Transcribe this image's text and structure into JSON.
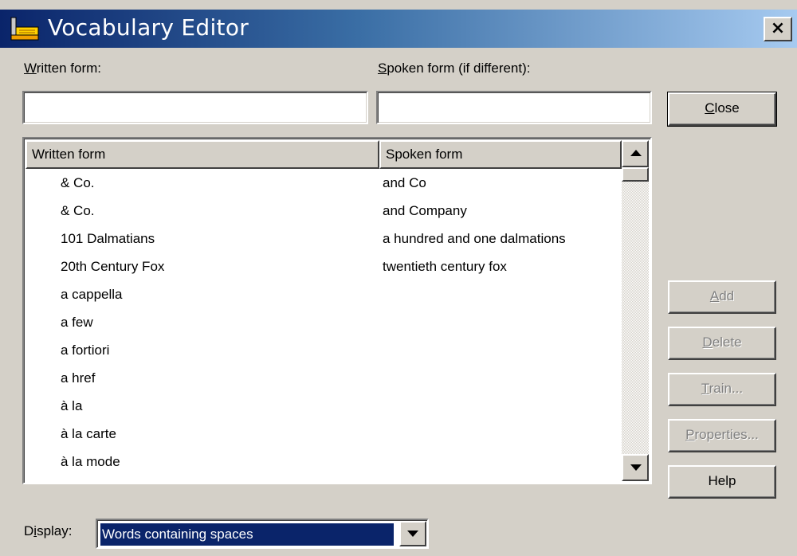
{
  "window": {
    "title": "Vocabulary Editor",
    "close_glyph": "×"
  },
  "form": {
    "written_label_accel": "W",
    "written_label_rest": "ritten form:",
    "written_value": "",
    "spoken_label_accel": "S",
    "spoken_label_rest": "poken form (if different):",
    "spoken_value": ""
  },
  "list": {
    "headers": {
      "written": "Written form",
      "spoken": "Spoken form"
    },
    "rows": [
      {
        "written": "& Co.",
        "spoken": "and Co"
      },
      {
        "written": "& Co.",
        "spoken": "and Company"
      },
      {
        "written": "101 Dalmatians",
        "spoken": "a hundred and one dalmations"
      },
      {
        "written": "20th Century Fox",
        "spoken": "twentieth century fox"
      },
      {
        "written": "a cappella",
        "spoken": ""
      },
      {
        "written": "a few",
        "spoken": ""
      },
      {
        "written": "a fortiori",
        "spoken": ""
      },
      {
        "written": "a href",
        "spoken": ""
      },
      {
        "written": "à la",
        "spoken": ""
      },
      {
        "written": "à la carte",
        "spoken": ""
      },
      {
        "written": "à la mode",
        "spoken": ""
      }
    ]
  },
  "buttons": {
    "close_accel": "C",
    "close_rest": "lose",
    "add_accel": "A",
    "add_rest": "dd",
    "delete_accel": "D",
    "delete_rest": "elete",
    "train_accel": "T",
    "train_rest": "rain...",
    "properties_accel": "P",
    "properties_rest": "roperties...",
    "help": "Help"
  },
  "display": {
    "label_pre": "D",
    "label_accel": "i",
    "label_post": "splay:",
    "selected": "Words containing spaces"
  },
  "icons": {
    "title": "vocabulary-editor-app-icon",
    "scroll_up": "scroll-up-arrow-icon",
    "scroll_down": "scroll-down-arrow-icon",
    "dropdown": "dropdown-arrow-icon"
  },
  "colors": {
    "titlebar_start": "#0a246a",
    "titlebar_end": "#a6caf0",
    "face": "#d4d0c8",
    "selection": "#0a246a",
    "disabled_text": "#808080"
  }
}
